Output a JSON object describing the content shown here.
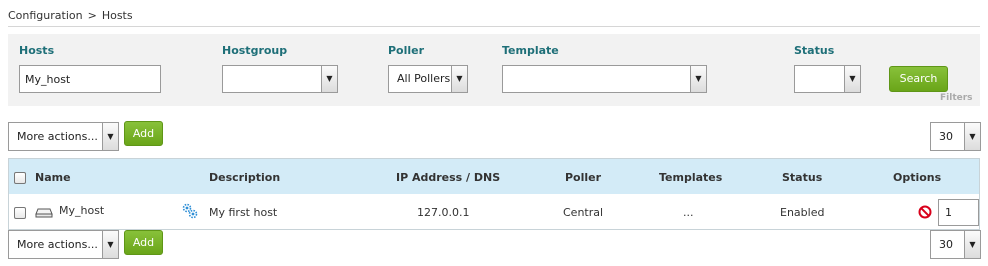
{
  "breadcrumb": {
    "root": "Configuration",
    "separator": ">",
    "current": "Hosts"
  },
  "filters": {
    "hosts_label": "Hosts",
    "hosts_value": "My_host",
    "hostgroup_label": "Hostgroup",
    "hostgroup_value": "",
    "poller_label": "Poller",
    "poller_value": "All Pollers",
    "template_label": "Template",
    "template_value": "",
    "status_label": "Status",
    "status_value": "",
    "search_label": "Search",
    "filters_tag": "Filters"
  },
  "actions_top": {
    "more_actions": "More actions...",
    "add_label": "Add",
    "page_size": "30"
  },
  "actions_bottom": {
    "more_actions": "More actions...",
    "add_label": "Add",
    "page_size": "30"
  },
  "table": {
    "columns": [
      "Name",
      "Description",
      "IP Address / DNS",
      "Poller",
      "Templates",
      "Status",
      "Options"
    ],
    "rows": [
      {
        "name": "My_host",
        "description": "My first host",
        "ip": "127.0.0.1",
        "poller": "Central",
        "templates": "...",
        "status": "Enabled",
        "options_value": "1"
      }
    ]
  },
  "icons": {
    "dropdown_arrow": "triangle-down",
    "host": "host-icon",
    "service_gear": "gears-icon",
    "disable": "no-entry-icon"
  },
  "colors": {
    "label_teal": "#1e6f78",
    "button_green": "#76b025",
    "header_blue": "#d3ebf7",
    "disable_red": "#d9001b"
  }
}
